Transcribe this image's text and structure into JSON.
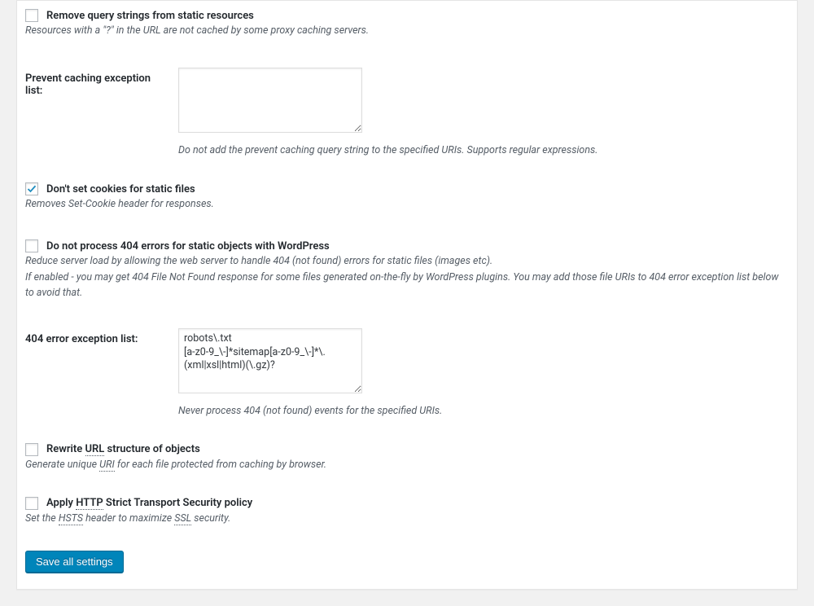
{
  "settings": {
    "remove_query_strings": {
      "label": "Remove query strings from static resources",
      "checked": false,
      "desc": "Resources with a \"?\" in the URL are not cached by some proxy caching servers."
    },
    "prevent_caching_exception": {
      "label": "Prevent caching exception list:",
      "value": "",
      "desc": "Do not add the prevent caching query string to the specified URIs. Supports regular expressions."
    },
    "no_cookies_static": {
      "label": "Don't set cookies for static files",
      "checked": true,
      "desc": "Removes Set-Cookie header for responses."
    },
    "no_404_wp": {
      "label": "Do not process 404 errors for static objects with WordPress",
      "checked": false,
      "desc1": "Reduce server load by allowing the web server to handle 404 (not found) errors for static files (images etc).",
      "desc2": "If enabled - you may get 404 File Not Found response for some files generated on-the-fly by WordPress plugins. You may add those file URIs to 404 error exception list below to avoid that."
    },
    "error_404_exception": {
      "label": "404 error exception list:",
      "value": "robots\\.txt\n[a-z0-9_\\-]*sitemap[a-z0-9_\\-]*\\.(xml|xsl|html)(\\.gz)?",
      "desc": "Never process 404 (not found) events for the specified URIs."
    },
    "rewrite_url": {
      "label_prefix": "Rewrite ",
      "label_abbr": "URL",
      "label_suffix": " structure of objects",
      "checked": false,
      "desc_prefix": "Generate unique ",
      "desc_abbr": "URI",
      "desc_suffix": " for each file protected from caching by browser."
    },
    "apply_hsts": {
      "label_prefix": "Apply ",
      "label_abbr": "HTTP",
      "label_suffix": " Strict Transport Security policy",
      "checked": false,
      "desc_prefix": "Set the ",
      "desc_abbr1": "HSTS",
      "desc_mid": " header to maximize ",
      "desc_abbr2": "SSL",
      "desc_suffix": " security."
    }
  },
  "buttons": {
    "save": "Save all settings"
  }
}
